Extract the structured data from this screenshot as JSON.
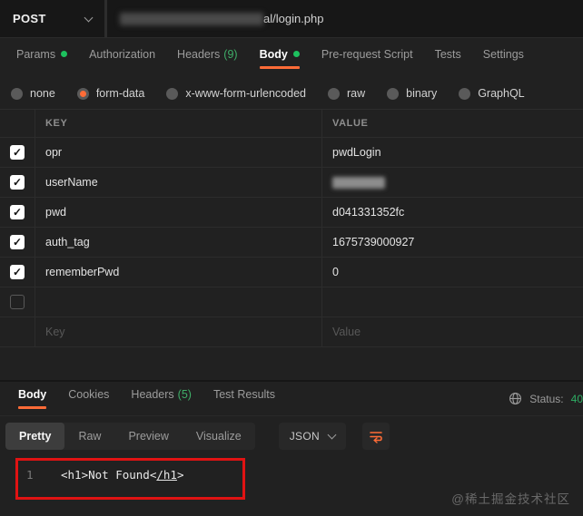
{
  "colors": {
    "accent_orange": "#ff6c37",
    "green": "#1dc15e",
    "annotation_red": "#e01313"
  },
  "request": {
    "method": "POST",
    "url_visible_text": "al/login.php",
    "tabs": [
      {
        "label": "Params",
        "dot": true,
        "active": false
      },
      {
        "label": "Authorization",
        "dot": false,
        "active": false
      },
      {
        "label": "Headers",
        "count": "(9)",
        "dot": false,
        "active": false
      },
      {
        "label": "Body",
        "dot": true,
        "active": true
      },
      {
        "label": "Pre-request Script",
        "dot": false,
        "active": false
      },
      {
        "label": "Tests",
        "dot": false,
        "active": false
      },
      {
        "label": "Settings",
        "dot": false,
        "active": false
      }
    ],
    "body_types": [
      {
        "label": "none",
        "selected": false
      },
      {
        "label": "form-data",
        "selected": true
      },
      {
        "label": "x-www-form-urlencoded",
        "selected": false
      },
      {
        "label": "raw",
        "selected": false
      },
      {
        "label": "binary",
        "selected": false
      },
      {
        "label": "GraphQL",
        "selected": false
      }
    ],
    "form": {
      "columns": [
        "KEY",
        "VALUE"
      ],
      "rows": [
        {
          "key": "opr",
          "value": "pwdLogin",
          "checked": true,
          "redacted_value": false
        },
        {
          "key": "userName",
          "value": "",
          "checked": true,
          "redacted_value": true
        },
        {
          "key": "pwd",
          "value": "d041331352fc",
          "checked": true,
          "redacted_value": false
        },
        {
          "key": "auth_tag",
          "value": "1675739000927",
          "checked": true,
          "redacted_value": false
        },
        {
          "key": "rememberPwd",
          "value": "0",
          "checked": true,
          "redacted_value": false
        },
        {
          "key": "",
          "value": "",
          "checked": false,
          "redacted_value": false
        }
      ],
      "placeholder_row": {
        "key": "Key",
        "value": "Value"
      }
    }
  },
  "response": {
    "tabs": [
      {
        "label": "Body",
        "active": true
      },
      {
        "label": "Cookies",
        "active": false
      },
      {
        "label": "Headers",
        "count": "(5)",
        "active": false
      },
      {
        "label": "Test Results",
        "active": false
      }
    ],
    "status_label": "Status:",
    "status_value": "40",
    "view_tabs": [
      {
        "label": "Pretty",
        "active": true
      },
      {
        "label": "Raw",
        "active": false
      },
      {
        "label": "Preview",
        "active": false
      },
      {
        "label": "Visualize",
        "active": false
      }
    ],
    "format_selected": "JSON",
    "code": {
      "line_number": "1",
      "text_head": "<h1>Not Found<",
      "text_link": "/h1",
      "text_tail": ">"
    }
  },
  "watermark": "@稀土掘金技术社区"
}
